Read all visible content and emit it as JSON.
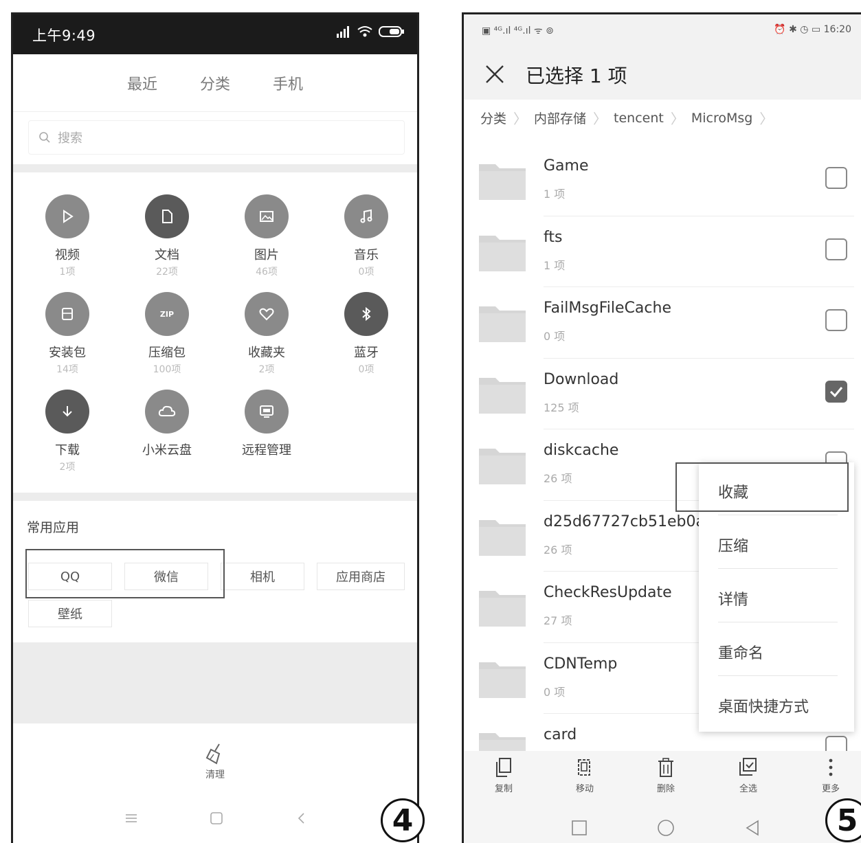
{
  "left": {
    "status": {
      "time": "上午9:49"
    },
    "tabs": [
      "最近",
      "分类",
      "手机"
    ],
    "search": {
      "placeholder": "搜索"
    },
    "categories": [
      {
        "name": "视频",
        "count": "1项",
        "icon": "play-icon"
      },
      {
        "name": "文档",
        "count": "22项",
        "icon": "document-icon"
      },
      {
        "name": "图片",
        "count": "46项",
        "icon": "image-icon"
      },
      {
        "name": "音乐",
        "count": "0项",
        "icon": "music-icon"
      },
      {
        "name": "安装包",
        "count": "14项",
        "icon": "package-icon"
      },
      {
        "name": "压缩包",
        "count": "100项",
        "icon": "zip-icon"
      },
      {
        "name": "收藏夹",
        "count": "2项",
        "icon": "heart-icon"
      },
      {
        "name": "蓝牙",
        "count": "0项",
        "icon": "bluetooth-icon"
      },
      {
        "name": "下载",
        "count": "2项",
        "icon": "download-icon"
      },
      {
        "name": "小米云盘",
        "count": "",
        "icon": "cloud-icon"
      },
      {
        "name": "远程管理",
        "count": "",
        "icon": "remote-icon"
      }
    ],
    "common_apps": {
      "title": "常用应用",
      "apps": [
        "QQ",
        "微信",
        "相机",
        "应用商店",
        "壁纸"
      ]
    },
    "clean_label": "清理",
    "step_number": "4"
  },
  "right": {
    "status": {
      "left": "▣ ⁴ᴳ.ıl ⁴ᴳ.ıl ᯤ ⊚",
      "right": "⏰ ✱ ◷ ▭ 16:20"
    },
    "header": {
      "title": "已选择 1 项"
    },
    "breadcrumb": [
      "分类",
      "内部存储",
      "tencent",
      "MicroMsg"
    ],
    "files": [
      {
        "name": "Game",
        "count": "1 项",
        "checked": false
      },
      {
        "name": "fts",
        "count": "1 项",
        "checked": false
      },
      {
        "name": "FailMsgFileCache",
        "count": "0 项",
        "checked": false
      },
      {
        "name": "Download",
        "count": "125 项",
        "checked": true
      },
      {
        "name": "diskcache",
        "count": "26 项",
        "checked": false
      },
      {
        "name": "d25d67727cb51eb0a",
        "count": "26 项",
        "checked": false
      },
      {
        "name": "CheckResUpdate",
        "count": "27 项",
        "checked": false
      },
      {
        "name": "CDNTemp",
        "count": "0 项",
        "checked": false
      },
      {
        "name": "card",
        "count": "",
        "checked": false
      }
    ],
    "context_menu": [
      "收藏",
      "压缩",
      "详情",
      "重命名",
      "桌面快捷方式"
    ],
    "toolbar": [
      "复制",
      "移动",
      "删除",
      "全选",
      "更多"
    ],
    "step_number": "5"
  },
  "colors": {
    "icon_gray": "#8a8a8a",
    "icon_dark": "#5a5a5a",
    "folder": "#d6d6d6",
    "band": "#ececec"
  }
}
